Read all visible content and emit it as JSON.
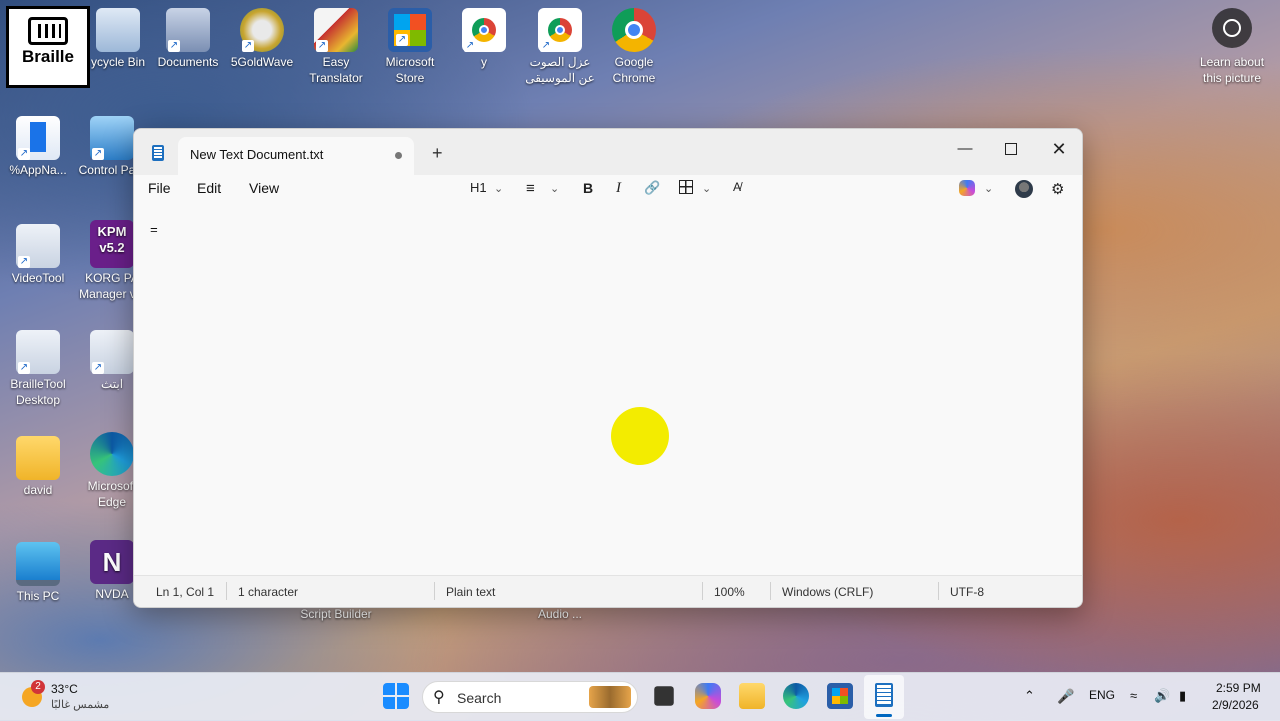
{
  "desktop": {
    "braille_label": "Braille",
    "icons": [
      {
        "label": "ycycle Bin"
      },
      {
        "label": "Documents"
      },
      {
        "label": "5GoldWave"
      },
      {
        "label": "Easy\nTranslator"
      },
      {
        "label": "Microsoft\nStore"
      },
      {
        "label": "y"
      },
      {
        "label": "عزل الصوت\nعن الموسيقى"
      },
      {
        "label": "Google\nChrome"
      },
      {
        "label": "%AppNa..."
      },
      {
        "label": "Control Pa..."
      },
      {
        "label": "VideoTool"
      },
      {
        "label": "KORG PA\nManager v..."
      },
      {
        "label": "BrailleTool\nDesktop"
      },
      {
        "label": "ابتث"
      },
      {
        "label": "david"
      },
      {
        "label": "Microsoft\nEdge"
      },
      {
        "label": "This PC"
      },
      {
        "label": "NVDA"
      }
    ],
    "partial_labels": [
      "Script Builder",
      "Audio ..."
    ],
    "learn_label": "Learn about\nthis picture",
    "kpm_text": "KPM\nv5.2"
  },
  "window": {
    "tab_title": "New Text Document.txt",
    "menu": {
      "file": "File",
      "edit": "Edit",
      "view": "View"
    },
    "toolbar": {
      "heading": "H1",
      "bold": "B",
      "italic": "I"
    },
    "content": "=",
    "status": {
      "position": "Ln 1, Col 1",
      "chars": "1 character",
      "format": "Plain text",
      "zoom": "100%",
      "eol": "Windows (CRLF)",
      "encoding": "UTF-8"
    }
  },
  "taskbar": {
    "weather_temp": "33°C",
    "weather_desc": "مشمس غالبًا",
    "weather_badge": "2",
    "search_label": "Search",
    "lang": "ENG",
    "time": "2:59 PM",
    "date": "2/9/2026"
  },
  "colors": {
    "accent": "#0067c0",
    "highlight_dot": "#f3ec00"
  }
}
